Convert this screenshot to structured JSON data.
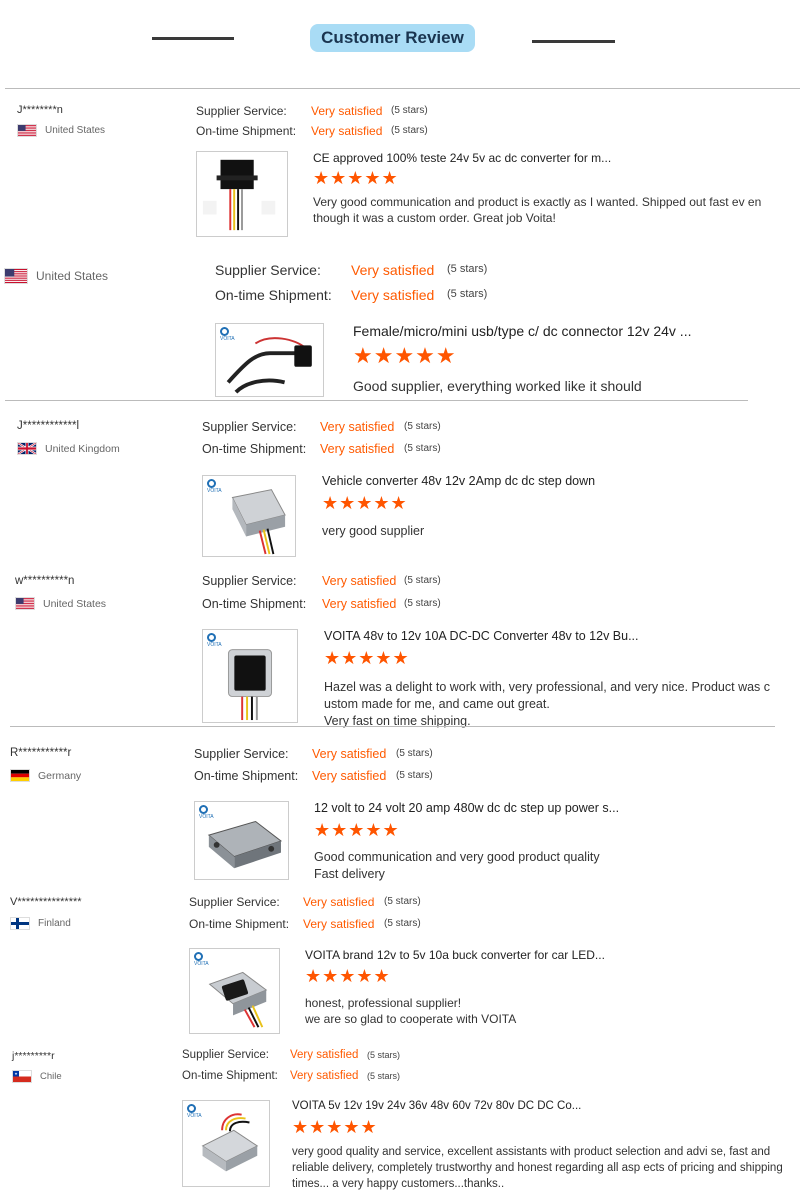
{
  "header": {
    "title": "Customer Review"
  },
  "labels": {
    "supplier": "Supplier Service:",
    "shipment": "On-time Shipment:"
  },
  "reviews": [
    {
      "user": "J********n",
      "country": "United States",
      "flag": "us",
      "supplier_rating": "Very satisfied",
      "supplier_stars": "(5 stars)",
      "shipment_rating": "Very satisfied",
      "shipment_stars": "(5 stars)",
      "product": "CE approved 100% teste 24v 5v ac dc converter for m...",
      "rating": "★★★★★",
      "comment": "Very good communication and product is exactly as I wanted. Shipped out fast ev en though it was a custom order. Great job Voita!"
    },
    {
      "user": "",
      "country": "United States",
      "flag": "us",
      "supplier_rating": "Very satisfied",
      "supplier_stars": "(5 stars)",
      "shipment_rating": "Very satisfied",
      "shipment_stars": "(5 stars)",
      "product": "Female/micro/mini usb/type c/ dc connector 12v 24v ...",
      "rating": "★★★★★",
      "comment": "Good supplier, everything worked like it should"
    },
    {
      "user": "J************l",
      "country": "United Kingdom",
      "flag": "uk",
      "supplier_rating": "Very satisfied",
      "supplier_stars": "(5 stars)",
      "shipment_rating": "Very satisfied",
      "shipment_stars": "(5 stars)",
      "product": "Vehicle converter 48v 12v 2Amp dc dc step down",
      "rating": "★★★★★",
      "comment": "very good supplier"
    },
    {
      "user": "w**********n",
      "country": "United States",
      "flag": "us",
      "supplier_rating": "Very satisfied",
      "supplier_stars": "(5 stars)",
      "shipment_rating": "Very satisfied",
      "shipment_stars": "(5 stars)",
      "product": "VOITA 48v to 12v 10A DC-DC Converter 48v to 12v Bu...",
      "rating": "★★★★★",
      "comment": "Hazel was a delight to work with, very professional, and very nice.  Product was c ustom made for me, and came out great.\nVery fast on time shipping."
    },
    {
      "user": "R***********r",
      "country": "Germany",
      "flag": "de",
      "supplier_rating": "Very satisfied",
      "supplier_stars": "(5 stars)",
      "shipment_rating": "Very satisfied",
      "shipment_stars": "(5 stars)",
      "product": "12 volt to 24 volt 20 amp 480w dc dc step up power s...",
      "rating": "★★★★★",
      "comment": "Good communication and very good product quality\nFast delivery"
    },
    {
      "user": "V***************",
      "country": "Finland",
      "flag": "fi",
      "supplier_rating": "Very satisfied",
      "supplier_stars": "(5 stars)",
      "shipment_rating": "Very satisfied",
      "shipment_stars": "(5 stars)",
      "product": "VOITA brand 12v to 5v 10a buck converter for car LED...",
      "rating": "★★★★★",
      "comment": "honest, professional supplier!\nwe are so glad to cooperate with VOITA"
    },
    {
      "user": "j*********r",
      "country": "Chile",
      "flag": "cl",
      "supplier_rating": "Very satisfied",
      "supplier_stars": "(5 stars)",
      "shipment_rating": "Very satisfied",
      "shipment_stars": "(5 stars)",
      "product": "VOITA 5v 12v 19v 24v 36v 48v 60v 72v 80v DC DC Co...",
      "rating": "★★★★★",
      "comment": "very good quality and service, excellent assistants with product selection and advi se, fast and reliable delivery, completely trustworthy and honest regarding all asp ects of pricing and shipping times... a very happy customers...thanks.."
    }
  ]
}
